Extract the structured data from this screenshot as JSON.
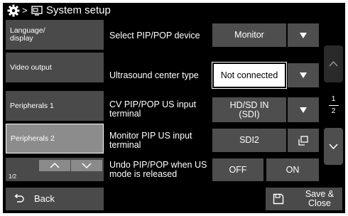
{
  "header": {
    "separator": ">",
    "title": "System setup"
  },
  "sidebar": {
    "items": [
      {
        "label": "Language/ display",
        "active": false
      },
      {
        "label": "Video output",
        "active": false
      },
      {
        "label": "Peripherals 1",
        "active": false
      },
      {
        "label": "Peripherals 2",
        "active": true
      }
    ],
    "page": "1/2"
  },
  "settings": {
    "pip_pop_device": {
      "label": "Select PIP/POP device",
      "value": "Monitor"
    },
    "ultrasound_center": {
      "label": "Ultrasound center type",
      "value": "Not connected"
    },
    "cv_pip_pop_terminal": {
      "label": "CV PIP/POP US input terminal",
      "value": "HD/SD IN (SDI)"
    },
    "monitor_pip_terminal": {
      "label": "Monitor PIP US input terminal",
      "value": "SDI2"
    },
    "undo_pip_pop": {
      "label": "Undo PIP/POP when US mode is released",
      "off_label": "OFF",
      "on_label": "ON"
    }
  },
  "pager": {
    "current": "1",
    "total": "2"
  },
  "footer": {
    "back_label": "Back",
    "save_label": "Save & Close"
  },
  "colors": {
    "background": "#000000",
    "button": "#4e4e4e",
    "active_tab": "#8c8c8c",
    "selected_value": "#ffffff"
  },
  "icons": [
    "gear-icon",
    "monitor-icon",
    "dropdown-arrow-icon",
    "popup-window-icon",
    "chevron-up-icon",
    "chevron-down-icon",
    "back-arrow-icon",
    "save-icon"
  ]
}
